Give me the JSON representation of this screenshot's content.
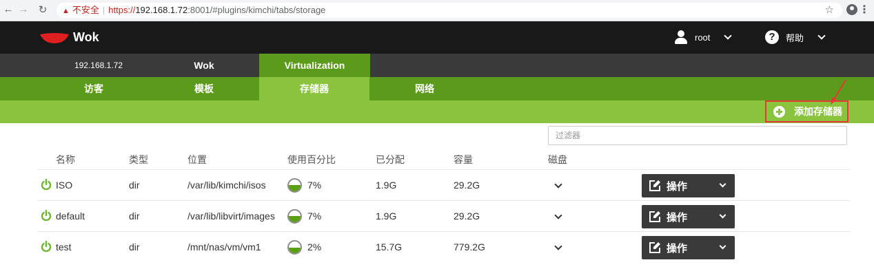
{
  "browser": {
    "insecure_label": "不安全",
    "url_scheme": "https://",
    "url_host": "192.168.1.72",
    "url_path": ":8001/#plugins/kimchi/tabs/storage"
  },
  "header": {
    "brand": "Wok",
    "user": "root",
    "help": "帮助"
  },
  "host_tabs": [
    "192.168.1.72",
    "Wok",
    "Virtualization"
  ],
  "sub_tabs": [
    "访客",
    "模板",
    "存储器",
    "网络"
  ],
  "active_sub_tab": "存储器",
  "add_storage_label": "添加存储器",
  "filter": {
    "placeholder": "过滤器",
    "value": ""
  },
  "table": {
    "headers": [
      "名称",
      "类型",
      "位置",
      "使用百分比",
      "已分配",
      "容量",
      "磁盘"
    ],
    "rows": [
      {
        "name": "ISO",
        "type": "dir",
        "location": "/var/lib/kimchi/isos",
        "usage": "7%",
        "usage_fraction": 0.07,
        "allocated": "1.9G",
        "capacity": "29.2G",
        "status": "active"
      },
      {
        "name": "default",
        "type": "dir",
        "location": "/var/lib/libvirt/images",
        "usage": "7%",
        "usage_fraction": 0.07,
        "allocated": "1.9G",
        "capacity": "29.2G",
        "status": "active"
      },
      {
        "name": "test",
        "type": "dir",
        "location": "/mnt/nas/vm/vm1",
        "usage": "2%",
        "usage_fraction": 0.02,
        "allocated": "15.7G",
        "capacity": "779.2G",
        "status": "active"
      }
    ],
    "action_label": "操作"
  },
  "colors": {
    "dark_header": "#191919",
    "host_bar": "#3a3a3a",
    "green_dark": "#5b9a1a",
    "green_light": "#8ac43f",
    "power_green": "#6cb52d",
    "annotation_red": "#e53935"
  }
}
